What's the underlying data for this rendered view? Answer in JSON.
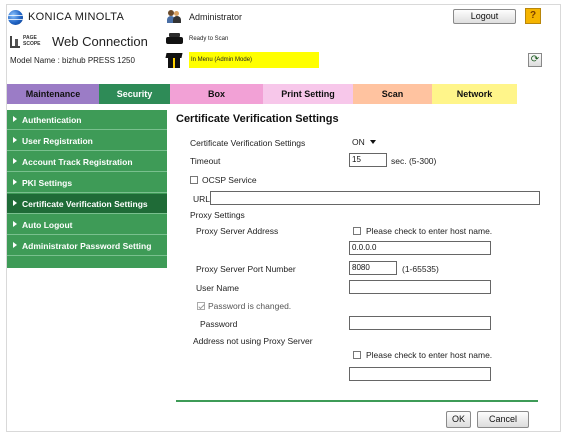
{
  "header": {
    "brand": "KONICA MINOLTA",
    "pagescope_word": "PAGE SCOPE",
    "app_title": "Web Connection",
    "model": "Model Name : bizhub PRESS 1250",
    "user": "Administrator",
    "logout_label": "Logout",
    "help_label": "?",
    "status_ready": "Ready to Scan",
    "status_menu": "In Menu (Admin Mode)",
    "refresh_label": "⟳"
  },
  "tabs": [
    {
      "label": "Maintenance"
    },
    {
      "label": "Security"
    },
    {
      "label": "Box"
    },
    {
      "label": "Print Setting"
    },
    {
      "label": "Scan"
    },
    {
      "label": "Network"
    }
  ],
  "sidebar": {
    "items": [
      {
        "label": "Authentication"
      },
      {
        "label": "User Registration"
      },
      {
        "label": "Account Track Registration"
      },
      {
        "label": "PKI Settings"
      },
      {
        "label": "Certificate Verification Settings"
      },
      {
        "label": "Auto Logout"
      },
      {
        "label": "Administrator Password Setting"
      }
    ],
    "active_index": 4
  },
  "form": {
    "title": "Certificate Verification Settings",
    "cvs_label": "Certificate Verification Settings",
    "cvs_value": "ON",
    "timeout_label": "Timeout",
    "timeout_value": "15",
    "timeout_unit": "sec. (5-300)",
    "ocsp_label": "OCSP Service",
    "url_label": "URL",
    "url_value": "",
    "proxy_settings_label": "Proxy Settings",
    "proxy_address_label": "Proxy Server Address",
    "host_check_label": "Please check to enter host name.",
    "proxy_address_value": "0.0.0.0",
    "proxy_port_label": "Proxy Server Port Number",
    "proxy_port_value": "8080",
    "proxy_port_range": "(1-65535)",
    "user_name_label": "User Name",
    "user_name_value": "",
    "password_changed_label": "Password is changed.",
    "password_label": "Password",
    "password_value": "",
    "no_proxy_label": "Address not using Proxy Server",
    "no_proxy_host_check_label": "Please check to enter host name.",
    "no_proxy_value": "",
    "ok_label": "OK",
    "cancel_label": "Cancel"
  }
}
